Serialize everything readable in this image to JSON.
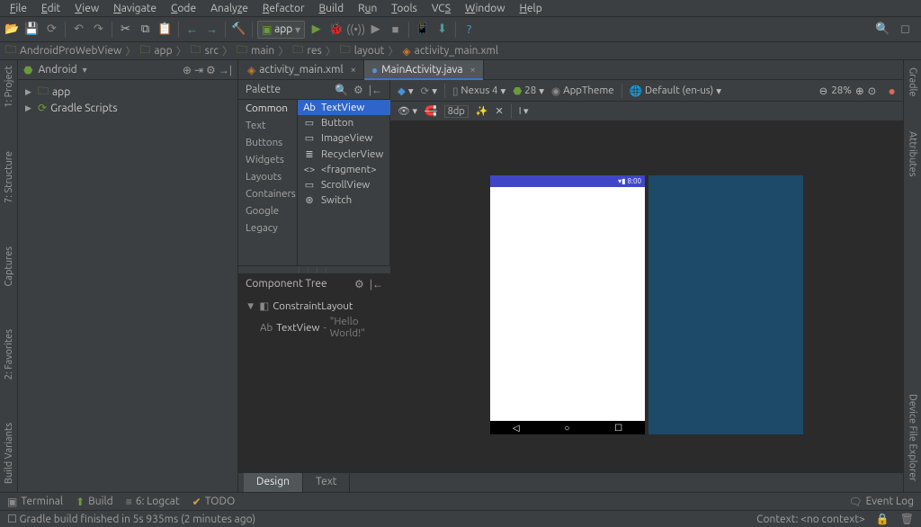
{
  "menu": [
    "File",
    "Edit",
    "View",
    "Navigate",
    "Code",
    "Analyze",
    "Refactor",
    "Build",
    "Run",
    "Tools",
    "VCS",
    "Window",
    "Help"
  ],
  "run_config": {
    "label": "app"
  },
  "breadcrumb": {
    "project": "AndroidProWebView",
    "items": [
      "app",
      "src",
      "main",
      "res",
      "layout",
      "activity_main.xml"
    ]
  },
  "project_panel": {
    "mode": "Android",
    "nodes": [
      {
        "label": "app",
        "icon": "module"
      },
      {
        "label": "Gradle Scripts",
        "icon": "gradle"
      }
    ]
  },
  "left_rail": [
    "1: Project",
    "7: Structure",
    "Captures",
    "2: Favorites",
    "Build Variants"
  ],
  "right_rail": [
    "Gradle",
    "Attributes",
    "Device File Explorer"
  ],
  "editor_tabs": [
    {
      "label": "activity_main.xml",
      "active": false
    },
    {
      "label": "MainActivity.java",
      "active": true
    }
  ],
  "palette": {
    "title": "Palette",
    "groups": [
      "Common",
      "Text",
      "Buttons",
      "Widgets",
      "Layouts",
      "Containers",
      "Google",
      "Legacy"
    ],
    "components": [
      {
        "icon": "Ab",
        "label": "TextView",
        "selected": true
      },
      {
        "icon": "▭",
        "label": "Button"
      },
      {
        "icon": "▭",
        "label": "ImageView"
      },
      {
        "icon": "≣",
        "label": "RecyclerView",
        "suffix": "⬇"
      },
      {
        "icon": "<>",
        "label": "<fragment>"
      },
      {
        "icon": "▭",
        "label": "ScrollView"
      },
      {
        "icon": "⊛",
        "label": "Switch"
      }
    ]
  },
  "component_tree": {
    "title": "Component Tree",
    "root": "ConstraintLayout",
    "child": "TextView",
    "child_detail": "\"Hello World!\""
  },
  "design_toolbar": {
    "device": "Nexus 4",
    "api": "28",
    "theme": "AppTheme",
    "locale": "Default (en-us)",
    "zoom": "28%",
    "gap": "8dp"
  },
  "phone": {
    "time": "8:00"
  },
  "design_tabs": [
    "Design",
    "Text"
  ],
  "bottom_bar": {
    "terminal": "Terminal",
    "build": "Build",
    "logcat": "6: Logcat",
    "todo": "TODO",
    "eventlog": "Event Log"
  },
  "status": {
    "message": "Gradle build finished in 5s 935ms (2 minutes ago)",
    "context": "Context: <no context>"
  }
}
